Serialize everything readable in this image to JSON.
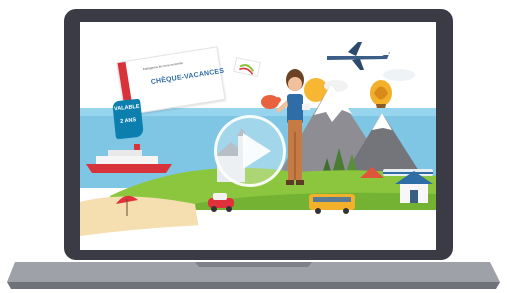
{
  "video_player": {
    "play_label": "",
    "play_icon": "play-icon"
  },
  "promo": {
    "card_tagline": "Partageons les bons moments",
    "card_title": "CHÈQUE-VACANCES",
    "validity_line1": "VALABLE",
    "validity_line2": "2 ANS"
  },
  "colors": {
    "sky": "#ffffff",
    "sea": "#7ec6e4",
    "grass": "#8cc63f",
    "laptop_frame": "#3b3b45",
    "brand_red": "#d8323a",
    "brand_blue": "#2f6da6"
  }
}
